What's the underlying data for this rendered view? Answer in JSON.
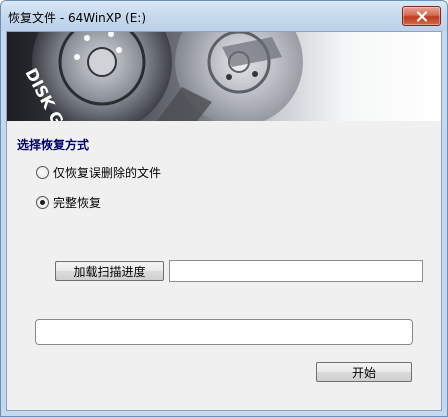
{
  "window": {
    "title": "恢复文件 - 64WinXP (E:)",
    "close_icon": "close-icon"
  },
  "banner": {
    "logo_text": "DISK GENIUS"
  },
  "recovery_mode": {
    "title": "选择恢复方式",
    "options": [
      {
        "label": "仅恢复误删除的文件",
        "checked": false
      },
      {
        "label": "完整恢复",
        "checked": true
      }
    ]
  },
  "scan_progress": {
    "load_button_label": "加载扫描进度",
    "path_value": ""
  },
  "progress": {
    "percent": 0
  },
  "start_button_label": "开始"
}
